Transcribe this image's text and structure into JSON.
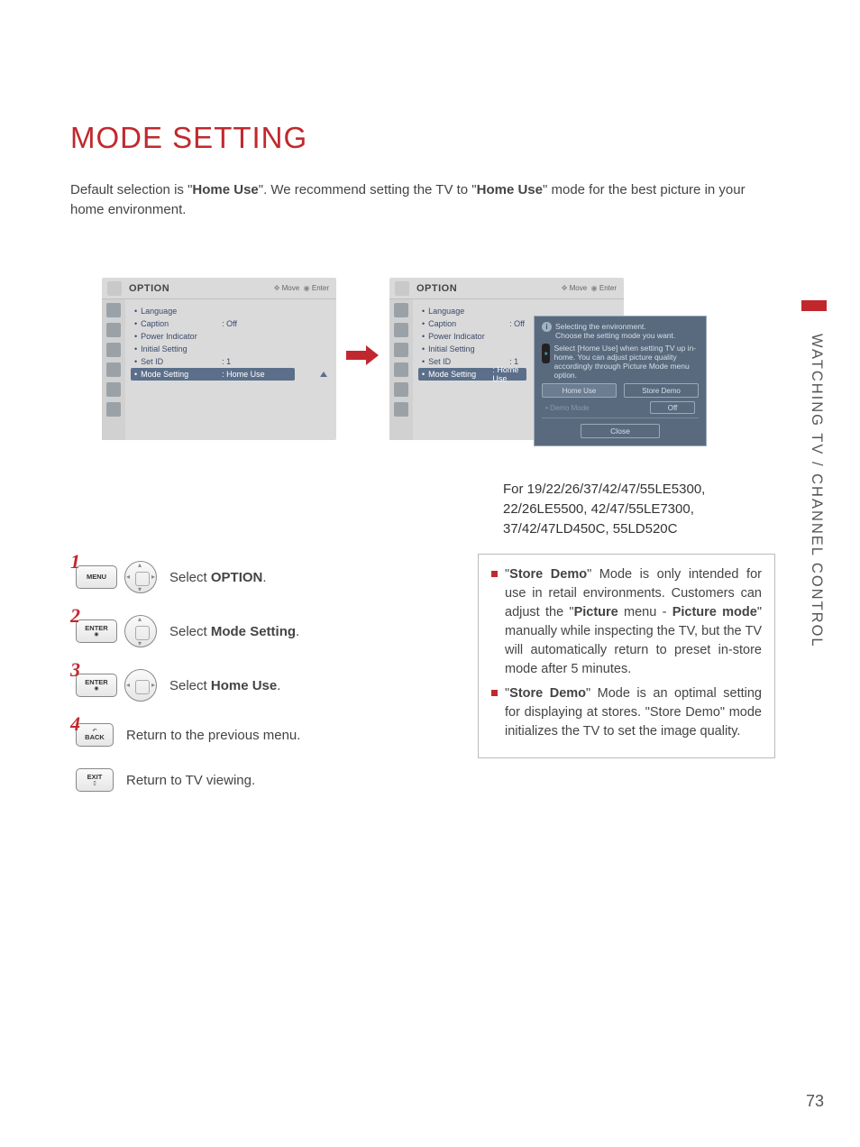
{
  "title": "MODE SETTING",
  "intro": {
    "pre": "Default selection is \"",
    "bold1": "Home Use",
    "mid": "\". We recommend setting the TV to \"",
    "bold2": "Home Use",
    "post": "\" mode for the best picture in your home environment."
  },
  "side_label": "WATCHING TV / CHANNEL CONTROL",
  "page_number": "73",
  "osd": {
    "title": "OPTION",
    "hints_move": "Move",
    "hints_enter": "Enter",
    "items": [
      {
        "label": "Language",
        "val": ""
      },
      {
        "label": "Caption",
        "val": ": Off"
      },
      {
        "label": "Power Indicator",
        "val": ""
      },
      {
        "label": "Initial Setting",
        "val": ""
      },
      {
        "label": "Set ID",
        "val": ": 1"
      },
      {
        "label": "Mode Setting",
        "val": ": Home Use"
      }
    ]
  },
  "popup": {
    "line1a": "Selecting the environment.",
    "line1b": "Choose the setting mode you want.",
    "line2": "Select [Home Use] when setting TV up in-home. You can adjust picture quality accordingly through Picture Mode menu option.",
    "btn_home": "Home Use",
    "btn_store": "Store Demo",
    "demo_label": "• Demo Mode",
    "demo_val": "Off",
    "close": "Close"
  },
  "models_note": "For 19/22/26/37/42/47/55LE5300, 22/26LE5500, 42/47/55LE7300, 37/42/47LD450C, 55LD520C",
  "steps": {
    "s1": {
      "btn": "MENU",
      "pre": "Select ",
      "bold": "OPTION",
      "post": "."
    },
    "s2": {
      "btn": "ENTER",
      "pre": "Select ",
      "bold": "Mode Setting",
      "post": "."
    },
    "s3": {
      "btn": "ENTER",
      "pre": "Select ",
      "bold": "Home Use",
      "post": "."
    },
    "s4": {
      "btn": "BACK",
      "text": "Return to the previous menu."
    },
    "s5": {
      "btn": "EXIT",
      "text": "Return to TV viewing."
    }
  },
  "info": {
    "b1": {
      "pre": "\"",
      "bold1": "Store Demo",
      "mid1": "\" Mode is only intended for use in retail environments. Customers can adjust the \"",
      "bold2": "Picture",
      "mid2": " menu - ",
      "bold3": "Picture mode",
      "post": "\" manually while inspecting the TV, but the TV will automatically return to preset in-store mode after 5 minutes."
    },
    "b2": {
      "pre": "\"",
      "bold1": "Store Demo",
      "post": "\" Mode is an optimal setting for displaying at stores. \"Store Demo\" mode initializes the TV to set the image quality."
    }
  }
}
